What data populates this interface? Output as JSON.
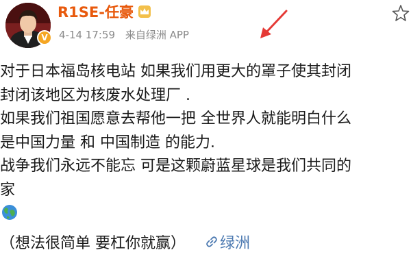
{
  "colors": {
    "username": "#e8590c",
    "meta": "#8a8a8a",
    "link": "#4a78b0",
    "annotation_arrow": "#e53935",
    "avatar_badge": "#f5a623"
  },
  "header": {
    "username": "R1SE-任豪",
    "timestamp": "4-14 17:59",
    "source": "来自绿洲 APP",
    "verified_icon": "crown-badge-icon",
    "favorite_icon": "star-outline-icon"
  },
  "post": {
    "lines": [
      "对于日本福岛核电站 如果我们用更大的罩子使其封闭",
      "封闭该地区为核废水处理厂 .",
      "如果我们祖国愿意去帮他一把 全世界人就能明白什么",
      "是中国力量 和 中国制造 的能力.",
      "战争我们永远不能忘 可是这颗蔚蓝星球是我们共同的",
      "家"
    ],
    "emoji_icon": "earth-globe-icon",
    "last_line": "（想法很简单 要杠你就赢）",
    "link_label": "绿洲",
    "link_icon": "link-icon"
  }
}
